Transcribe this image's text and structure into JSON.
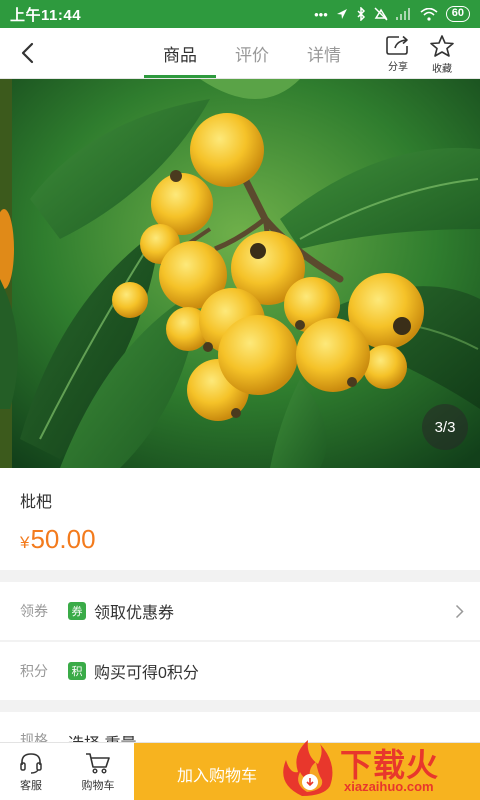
{
  "status_bar": {
    "time": "上午11:44",
    "battery": "60",
    "icons": [
      "dots-icon",
      "location-icon",
      "bluetooth-icon",
      "mute-icon",
      "signal-icon",
      "wifi-icon",
      "battery-icon"
    ]
  },
  "nav": {
    "tabs": [
      {
        "label": "商品",
        "active": true
      },
      {
        "label": "评价",
        "active": false
      },
      {
        "label": "详情",
        "active": false
      }
    ],
    "share_label": "分享",
    "favorite_label": "收藏"
  },
  "gallery": {
    "page_indicator": "3/3",
    "image_subject": "loquat fruit cluster on branch"
  },
  "product": {
    "name": "枇杷",
    "currency": "¥",
    "price": "50.00"
  },
  "coupon_row": {
    "key": "领券",
    "badge": "券",
    "value": "领取优惠券"
  },
  "points_row": {
    "key": "积分",
    "badge": "积",
    "value": "购买可得0积分"
  },
  "spec_row": {
    "key": "规格",
    "value": "选择 重量"
  },
  "bottom_bar": {
    "service_label": "客服",
    "cart_label": "购物车",
    "add_to_cart_label": "加入购物车"
  },
  "watermark": {
    "title": "下载火",
    "url": "xiazaihuo.com"
  },
  "colors": {
    "brand_green": "#2e9a3e",
    "price_orange": "#f37b1d",
    "cart_yellow": "#f7b31f",
    "watermark_red": "#e8372c"
  }
}
